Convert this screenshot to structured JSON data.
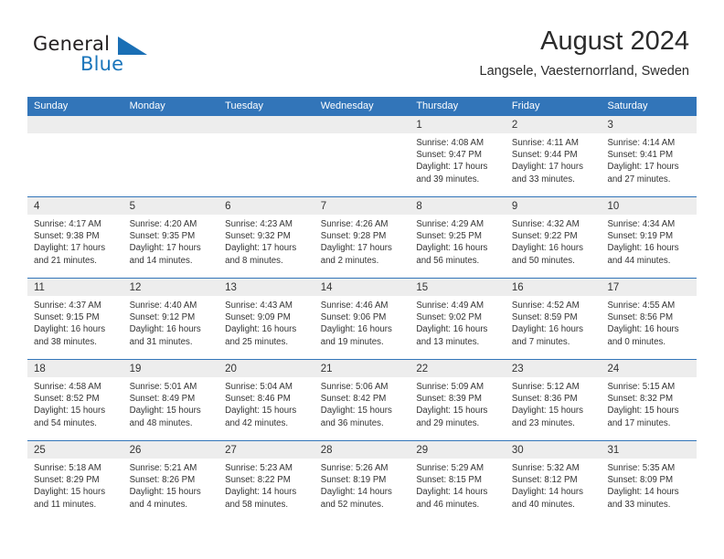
{
  "brand": {
    "name_part1": "General",
    "name_part2": "Blue",
    "flag_icon": "triangle-flag-icon"
  },
  "header": {
    "title": "August 2024",
    "location": "Langsele, Vaesternorrland, Sweden"
  },
  "calendar": {
    "weekday_headers": [
      "Sunday",
      "Monday",
      "Tuesday",
      "Wednesday",
      "Thursday",
      "Friday",
      "Saturday"
    ],
    "accent_color": "#3275b9",
    "daynum_band_color": "#ededed",
    "weeks": [
      [
        {
          "day": "",
          "lines": []
        },
        {
          "day": "",
          "lines": []
        },
        {
          "day": "",
          "lines": []
        },
        {
          "day": "",
          "lines": []
        },
        {
          "day": "1",
          "lines": [
            "Sunrise: 4:08 AM",
            "Sunset: 9:47 PM",
            "Daylight: 17 hours",
            "and 39 minutes."
          ]
        },
        {
          "day": "2",
          "lines": [
            "Sunrise: 4:11 AM",
            "Sunset: 9:44 PM",
            "Daylight: 17 hours",
            "and 33 minutes."
          ]
        },
        {
          "day": "3",
          "lines": [
            "Sunrise: 4:14 AM",
            "Sunset: 9:41 PM",
            "Daylight: 17 hours",
            "and 27 minutes."
          ]
        }
      ],
      [
        {
          "day": "4",
          "lines": [
            "Sunrise: 4:17 AM",
            "Sunset: 9:38 PM",
            "Daylight: 17 hours",
            "and 21 minutes."
          ]
        },
        {
          "day": "5",
          "lines": [
            "Sunrise: 4:20 AM",
            "Sunset: 9:35 PM",
            "Daylight: 17 hours",
            "and 14 minutes."
          ]
        },
        {
          "day": "6",
          "lines": [
            "Sunrise: 4:23 AM",
            "Sunset: 9:32 PM",
            "Daylight: 17 hours",
            "and 8 minutes."
          ]
        },
        {
          "day": "7",
          "lines": [
            "Sunrise: 4:26 AM",
            "Sunset: 9:28 PM",
            "Daylight: 17 hours",
            "and 2 minutes."
          ]
        },
        {
          "day": "8",
          "lines": [
            "Sunrise: 4:29 AM",
            "Sunset: 9:25 PM",
            "Daylight: 16 hours",
            "and 56 minutes."
          ]
        },
        {
          "day": "9",
          "lines": [
            "Sunrise: 4:32 AM",
            "Sunset: 9:22 PM",
            "Daylight: 16 hours",
            "and 50 minutes."
          ]
        },
        {
          "day": "10",
          "lines": [
            "Sunrise: 4:34 AM",
            "Sunset: 9:19 PM",
            "Daylight: 16 hours",
            "and 44 minutes."
          ]
        }
      ],
      [
        {
          "day": "11",
          "lines": [
            "Sunrise: 4:37 AM",
            "Sunset: 9:15 PM",
            "Daylight: 16 hours",
            "and 38 minutes."
          ]
        },
        {
          "day": "12",
          "lines": [
            "Sunrise: 4:40 AM",
            "Sunset: 9:12 PM",
            "Daylight: 16 hours",
            "and 31 minutes."
          ]
        },
        {
          "day": "13",
          "lines": [
            "Sunrise: 4:43 AM",
            "Sunset: 9:09 PM",
            "Daylight: 16 hours",
            "and 25 minutes."
          ]
        },
        {
          "day": "14",
          "lines": [
            "Sunrise: 4:46 AM",
            "Sunset: 9:06 PM",
            "Daylight: 16 hours",
            "and 19 minutes."
          ]
        },
        {
          "day": "15",
          "lines": [
            "Sunrise: 4:49 AM",
            "Sunset: 9:02 PM",
            "Daylight: 16 hours",
            "and 13 minutes."
          ]
        },
        {
          "day": "16",
          "lines": [
            "Sunrise: 4:52 AM",
            "Sunset: 8:59 PM",
            "Daylight: 16 hours",
            "and 7 minutes."
          ]
        },
        {
          "day": "17",
          "lines": [
            "Sunrise: 4:55 AM",
            "Sunset: 8:56 PM",
            "Daylight: 16 hours",
            "and 0 minutes."
          ]
        }
      ],
      [
        {
          "day": "18",
          "lines": [
            "Sunrise: 4:58 AM",
            "Sunset: 8:52 PM",
            "Daylight: 15 hours",
            "and 54 minutes."
          ]
        },
        {
          "day": "19",
          "lines": [
            "Sunrise: 5:01 AM",
            "Sunset: 8:49 PM",
            "Daylight: 15 hours",
            "and 48 minutes."
          ]
        },
        {
          "day": "20",
          "lines": [
            "Sunrise: 5:04 AM",
            "Sunset: 8:46 PM",
            "Daylight: 15 hours",
            "and 42 minutes."
          ]
        },
        {
          "day": "21",
          "lines": [
            "Sunrise: 5:06 AM",
            "Sunset: 8:42 PM",
            "Daylight: 15 hours",
            "and 36 minutes."
          ]
        },
        {
          "day": "22",
          "lines": [
            "Sunrise: 5:09 AM",
            "Sunset: 8:39 PM",
            "Daylight: 15 hours",
            "and 29 minutes."
          ]
        },
        {
          "day": "23",
          "lines": [
            "Sunrise: 5:12 AM",
            "Sunset: 8:36 PM",
            "Daylight: 15 hours",
            "and 23 minutes."
          ]
        },
        {
          "day": "24",
          "lines": [
            "Sunrise: 5:15 AM",
            "Sunset: 8:32 PM",
            "Daylight: 15 hours",
            "and 17 minutes."
          ]
        }
      ],
      [
        {
          "day": "25",
          "lines": [
            "Sunrise: 5:18 AM",
            "Sunset: 8:29 PM",
            "Daylight: 15 hours",
            "and 11 minutes."
          ]
        },
        {
          "day": "26",
          "lines": [
            "Sunrise: 5:21 AM",
            "Sunset: 8:26 PM",
            "Daylight: 15 hours",
            "and 4 minutes."
          ]
        },
        {
          "day": "27",
          "lines": [
            "Sunrise: 5:23 AM",
            "Sunset: 8:22 PM",
            "Daylight: 14 hours",
            "and 58 minutes."
          ]
        },
        {
          "day": "28",
          "lines": [
            "Sunrise: 5:26 AM",
            "Sunset: 8:19 PM",
            "Daylight: 14 hours",
            "and 52 minutes."
          ]
        },
        {
          "day": "29",
          "lines": [
            "Sunrise: 5:29 AM",
            "Sunset: 8:15 PM",
            "Daylight: 14 hours",
            "and 46 minutes."
          ]
        },
        {
          "day": "30",
          "lines": [
            "Sunrise: 5:32 AM",
            "Sunset: 8:12 PM",
            "Daylight: 14 hours",
            "and 40 minutes."
          ]
        },
        {
          "day": "31",
          "lines": [
            "Sunrise: 5:35 AM",
            "Sunset: 8:09 PM",
            "Daylight: 14 hours",
            "and 33 minutes."
          ]
        }
      ]
    ]
  }
}
